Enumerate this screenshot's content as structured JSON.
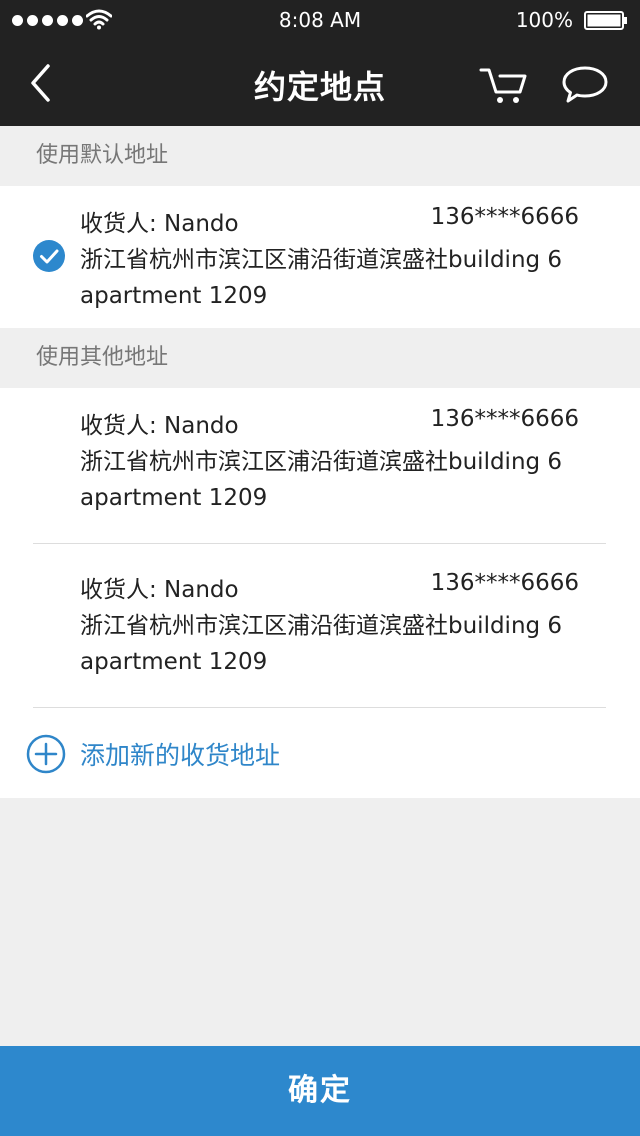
{
  "status_bar": {
    "time": "8:08 AM",
    "battery": "100%"
  },
  "nav": {
    "title": "约定地点",
    "icons": [
      "back-arrow-icon",
      "cart-icon",
      "chat-icon"
    ]
  },
  "default_section": {
    "header": "使用默认地址",
    "address": {
      "name": "收货人: Nando",
      "phone": "136****6666",
      "address": "浙江省杭州市滨江区浦沿街道滨盛社building 6 apartment 1209",
      "selected": true
    }
  },
  "other_section": {
    "header": "使用其他地址",
    "addresses": [
      {
        "name": "收货人: Nando",
        "phone": "136****6666",
        "address": "浙江省杭州市滨江区浦沿街道滨盛社building 6 apartment 1209"
      },
      {
        "name": "收货人: Nando",
        "phone": "136****6666",
        "address": "浙江省杭州市滨江区浦沿街道滨盛社building 6 apartment 1209"
      }
    ],
    "add_label": "添加新的收货地址"
  },
  "confirm_label": "确定",
  "colors": {
    "nav_background": "#222222",
    "accent": "#2d88cd",
    "link": "#2f86c9",
    "page_background": "#efefef"
  }
}
